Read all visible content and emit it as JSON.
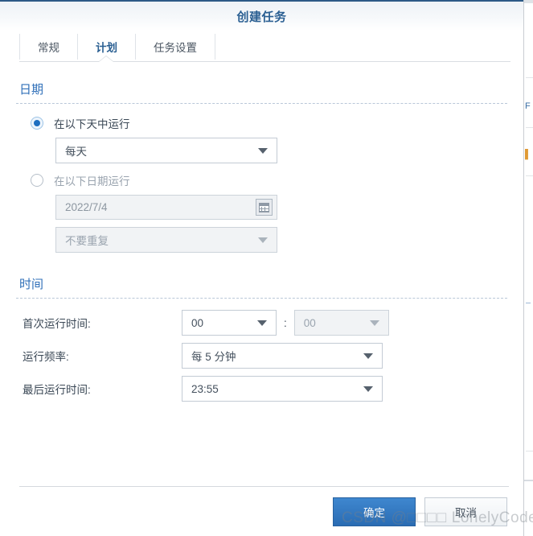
{
  "dialog": {
    "title": "创建任务",
    "accent_color": "#2a5f92",
    "section_title_color": "#2f6fb8",
    "primary_button_color": "#2a6cb3"
  },
  "tabs": [
    {
      "label": "常规",
      "active": false
    },
    {
      "label": "计划",
      "active": true
    },
    {
      "label": "任务设置",
      "active": false
    }
  ],
  "date_section": {
    "title": "日期",
    "option_days": {
      "label": "在以下天中运行",
      "selected": true,
      "dropdown_value": "每天"
    },
    "option_date": {
      "label": "在以下日期运行",
      "selected": false,
      "date_value": "2022/7/4",
      "calendar_icon": "calendar-icon",
      "repeat_value": "不要重复"
    }
  },
  "time_section": {
    "title": "时间",
    "rows": [
      {
        "label": "首次运行时间:",
        "hour_value": "00",
        "separator": ":",
        "minute_value": "00",
        "minute_disabled": true
      },
      {
        "label": "运行频率:",
        "value": "每 5 分钟"
      },
      {
        "label": "最后运行时间:",
        "value": "23:55"
      }
    ]
  },
  "footer": {
    "confirm_label": "确定",
    "cancel_label": "取消"
  },
  "watermark": {
    "prefix": "CSDN @",
    "tofu": "□□□□",
    "suffix": " LonelyCoder"
  }
}
